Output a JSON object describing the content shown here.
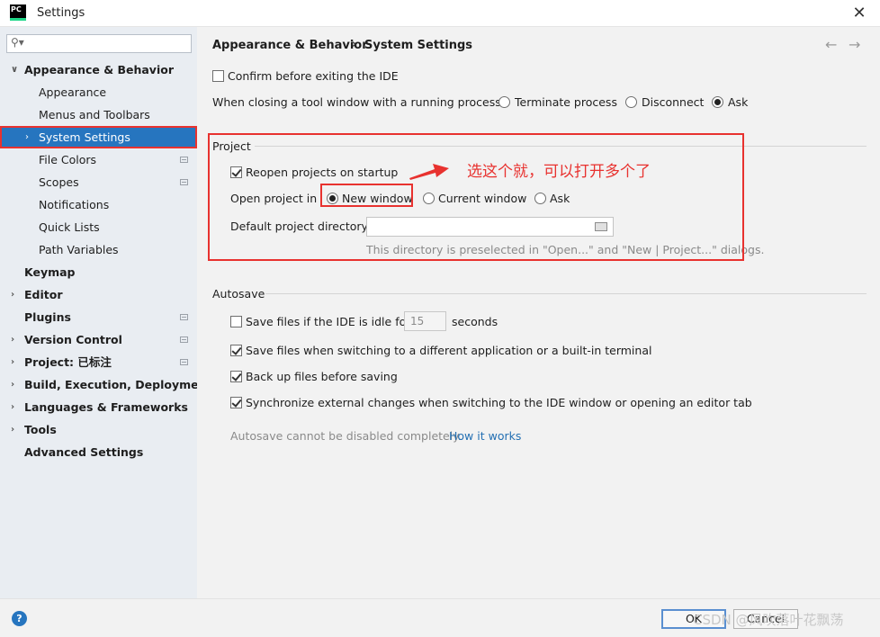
{
  "window": {
    "logo_text": "PC",
    "title": "Settings",
    "close_glyph": "✕"
  },
  "search": {
    "placeholder": "",
    "value": ""
  },
  "sidebar": {
    "items": [
      {
        "label": "Appearance & Behavior",
        "bold": true,
        "arrow": "expanded"
      },
      {
        "label": "Appearance"
      },
      {
        "label": "Menus and Toolbars"
      },
      {
        "label": "System Settings",
        "selected": true,
        "arrow": "collapsed"
      },
      {
        "label": "File Colors",
        "project_icon": true
      },
      {
        "label": "Scopes",
        "project_icon": true
      },
      {
        "label": "Notifications"
      },
      {
        "label": "Quick Lists"
      },
      {
        "label": "Path Variables"
      },
      {
        "label": "Keymap",
        "bold": true
      },
      {
        "label": "Editor",
        "bold": true,
        "arrow": "collapsed"
      },
      {
        "label": "Plugins",
        "bold": true,
        "project_icon": true
      },
      {
        "label": "Version Control",
        "bold": true,
        "arrow": "collapsed",
        "project_icon": true
      },
      {
        "label": "Project: 已标注",
        "bold": true,
        "arrow": "collapsed",
        "project_icon": true
      },
      {
        "label": "Build, Execution, Deployment",
        "bold": true,
        "arrow": "collapsed"
      },
      {
        "label": "Languages & Frameworks",
        "bold": true,
        "arrow": "collapsed"
      },
      {
        "label": "Tools",
        "bold": true,
        "arrow": "collapsed"
      },
      {
        "label": "Advanced Settings",
        "bold": true
      }
    ]
  },
  "breadcrumb": {
    "parent": "Appearance & Behavior",
    "separator": "›",
    "current": "System Settings",
    "back_glyph": "←",
    "forward_glyph": "→"
  },
  "general": {
    "confirm_exit": {
      "label": "Confirm before exiting the IDE",
      "checked": false
    },
    "closing_label": "When closing a tool window with a running process:",
    "closing_options": [
      {
        "label": "Terminate process",
        "selected": false
      },
      {
        "label": "Disconnect",
        "selected": false
      },
      {
        "label": "Ask",
        "selected": true
      }
    ]
  },
  "project": {
    "title": "Project",
    "reopen": {
      "label": "Reopen projects on startup",
      "checked": true
    },
    "open_in_label": "Open project in",
    "open_in_options": [
      {
        "label": "New window",
        "selected": true
      },
      {
        "label": "Current window",
        "selected": false
      },
      {
        "label": "Ask",
        "selected": false
      }
    ],
    "default_dir_label": "Default project directory:",
    "default_dir_value": "",
    "default_dir_hint": "This directory is preselected in \"Open...\" and \"New | Project...\" dialogs."
  },
  "annotation": {
    "text": "选这个就，可以打开多个了",
    "color": "#e8322f"
  },
  "autosave": {
    "title": "Autosave",
    "idle": {
      "label": "Save files if the IDE is idle for",
      "checked": false,
      "value": "15",
      "unit": "seconds"
    },
    "switching": {
      "label": "Save files when switching to a different application or a built-in terminal",
      "checked": true
    },
    "backup": {
      "label": "Back up files before saving",
      "checked": true
    },
    "sync": {
      "label": "Synchronize external changes when switching to the IDE window or opening an editor tab",
      "checked": true
    },
    "note": "Autosave cannot be disabled completely.",
    "note_link": "How it works"
  },
  "footer": {
    "help_glyph": "?",
    "ok_label": "OK",
    "cancel_label": "Cancel",
    "watermark": "CSDN @风吹落叶花飘荡"
  },
  "colors": {
    "selection": "#2675bf",
    "sidebar_bg": "#e9edf2",
    "panel_bg": "#f2f2f2",
    "link": "#2470b3",
    "annotation_red": "#e8322f"
  }
}
